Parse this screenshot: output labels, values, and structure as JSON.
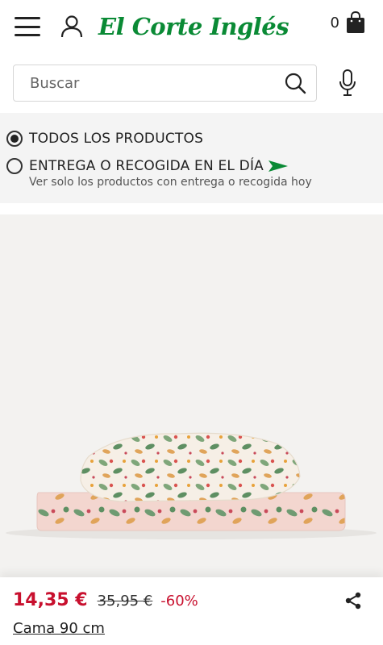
{
  "header": {
    "logo_text": "El Corte Inglés",
    "cart_count": "0",
    "brand_color": "#0a8a35"
  },
  "search": {
    "placeholder": "Buscar"
  },
  "filters": {
    "all_products_label": "TODOS LOS PRODUCTOS",
    "same_day_label": "ENTREGA O RECOGIDA EN EL DÍA",
    "same_day_sub": "Ver solo los productos con entrega o recogida hoy",
    "selected": "all_products"
  },
  "product": {
    "price": "14,35 €",
    "old_price": "35,95 €",
    "discount": "-60%",
    "size_option": "Cama 90 cm",
    "price_color": "#c8102e"
  },
  "icons": [
    "menu-icon",
    "user-icon",
    "shopping-bag-icon",
    "search-icon",
    "microphone-icon",
    "arrow-flag-icon",
    "share-icon"
  ]
}
